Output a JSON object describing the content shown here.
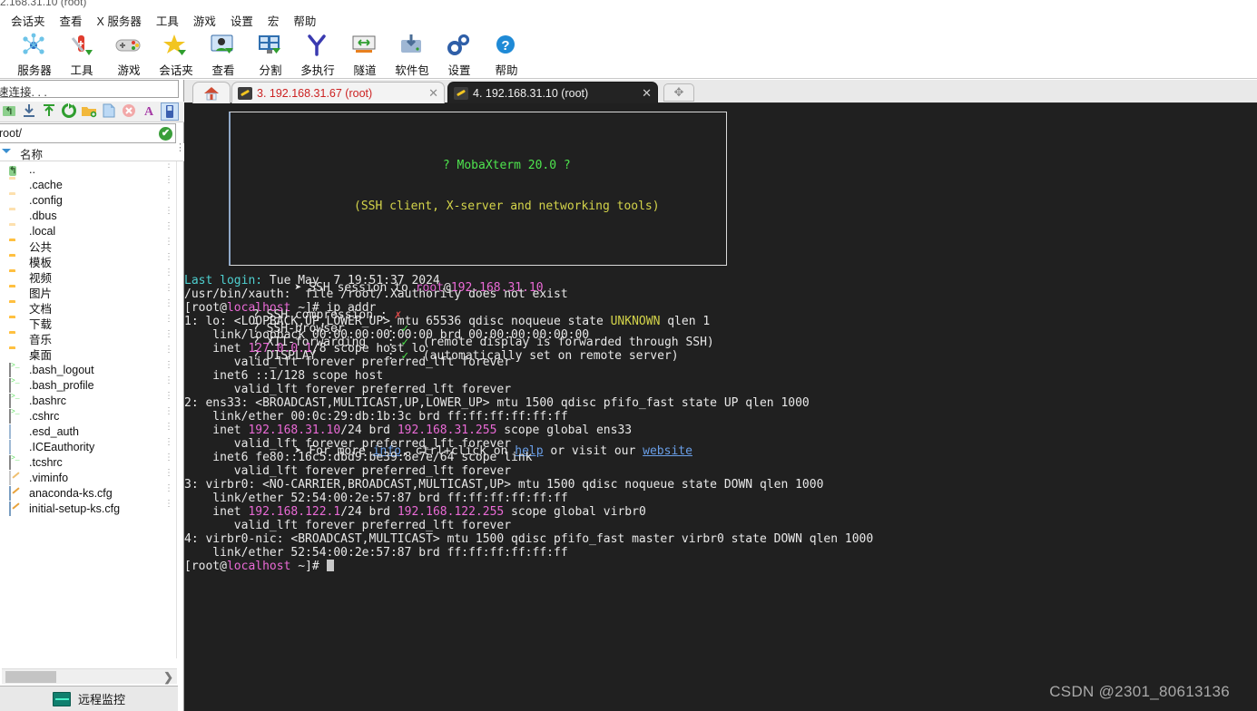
{
  "window": {
    "title": "2.168.31.10 (root)"
  },
  "menu": {
    "items": [
      "会话夹",
      "查看",
      "X 服务器",
      "工具",
      "游戏",
      "设置",
      "宏",
      "帮助"
    ]
  },
  "ribbon": {
    "buttons": [
      {
        "label": "服务器",
        "icon": "servers-icon"
      },
      {
        "label": "工具",
        "icon": "tools-icon"
      },
      {
        "label": "游戏",
        "icon": "games-icon"
      },
      {
        "label": "会话夹",
        "icon": "sessions-star-icon"
      },
      {
        "label": "查看",
        "icon": "view-icon"
      },
      {
        "label": "分割",
        "icon": "split-icon"
      },
      {
        "label": "多执行",
        "icon": "multiexec-icon"
      },
      {
        "label": "隧道",
        "icon": "tunnel-icon"
      },
      {
        "label": "软件包",
        "icon": "packages-icon"
      },
      {
        "label": "设置",
        "icon": "settings-gear-icon"
      },
      {
        "label": "帮助",
        "icon": "help-question-icon"
      }
    ]
  },
  "quick_connect": {
    "text": "速连接. . ."
  },
  "sftp": {
    "tools": [
      "upload-parent-icon",
      "download-icon",
      "upload-icon",
      "refresh-icon",
      "new-folder-icon",
      "new-file-icon",
      "delete-icon",
      "text-mode-icon",
      "drive-icon"
    ],
    "selected_tool_index": 8,
    "path": "root/",
    "path_ok": "✔",
    "column_header": "名称",
    "files": [
      {
        "name": "..",
        "icon": "up-folder-icon",
        "type": "up"
      },
      {
        "name": ".cache",
        "icon": "folder-icon",
        "type": "folder-light"
      },
      {
        "name": ".config",
        "icon": "folder-icon",
        "type": "folder-light"
      },
      {
        "name": ".dbus",
        "icon": "folder-icon",
        "type": "folder-light"
      },
      {
        "name": ".local",
        "icon": "folder-icon",
        "type": "folder-light"
      },
      {
        "name": "公共",
        "icon": "folder-icon",
        "type": "folder"
      },
      {
        "name": "模板",
        "icon": "folder-icon",
        "type": "folder"
      },
      {
        "name": "视频",
        "icon": "folder-icon",
        "type": "folder"
      },
      {
        "name": "图片",
        "icon": "folder-icon",
        "type": "folder"
      },
      {
        "name": "文档",
        "icon": "folder-icon",
        "type": "folder"
      },
      {
        "name": "下载",
        "icon": "folder-icon",
        "type": "folder"
      },
      {
        "name": "音乐",
        "icon": "folder-icon",
        "type": "folder"
      },
      {
        "name": "桌面",
        "icon": "folder-icon",
        "type": "folder"
      },
      {
        "name": ".bash_logout",
        "icon": "shell-file-icon",
        "type": "shell"
      },
      {
        "name": ".bash_profile",
        "icon": "shell-file-icon",
        "type": "shell"
      },
      {
        "name": ".bashrc",
        "icon": "shell-file-icon",
        "type": "shell"
      },
      {
        "name": ".cshrc",
        "icon": "shell-file-icon",
        "type": "shell"
      },
      {
        "name": ".esd_auth",
        "icon": "document-icon",
        "type": "doc"
      },
      {
        "name": ".ICEauthority",
        "icon": "document-icon",
        "type": "doc"
      },
      {
        "name": ".tcshrc",
        "icon": "shell-file-icon",
        "type": "shell"
      },
      {
        "name": ".viminfo",
        "icon": "viminfo-icon",
        "type": "vim"
      },
      {
        "name": "anaconda-ks.cfg",
        "icon": "config-file-icon",
        "type": "cfg"
      },
      {
        "name": "initial-setup-ks.cfg",
        "icon": "config-file-icon",
        "type": "cfg"
      }
    ]
  },
  "monitor_button": {
    "label": "远程监控",
    "icon": "monitor-graph-icon"
  },
  "tabs": {
    "home_label": "",
    "items": [
      {
        "label": "3. 192.168.31.67 (root)",
        "active": false
      },
      {
        "label": "4. 192.168.31.10 (root)",
        "active": true
      }
    ],
    "new_tab_label": "✥",
    "close_label": "✕"
  },
  "terminal": {
    "banner": {
      "title": "? MobaXterm 20.0 ?",
      "subtitle": "(SSH client, X-server and networking tools)",
      "session_prefix": "➤ SSH session to ",
      "session_user": "root",
      "session_at": "@",
      "session_host": "192.168.31.10",
      "rows": [
        {
          "label": "? SSH compression : ",
          "mark": "✗",
          "mark_color": "red",
          "note": ""
        },
        {
          "label": "? SSH-browser      : ",
          "mark": "✓",
          "mark_color": "green",
          "note": ""
        },
        {
          "label": "? X11-forwarding   : ",
          "mark": "✓",
          "mark_color": "green",
          "note": "  (remote display is forwarded through SSH)"
        },
        {
          "label": "? DISPLAY          : ",
          "mark": "✓",
          "mark_color": "green",
          "note": "  (automatically set on remote server)"
        }
      ],
      "footer_a": "➤ For more ",
      "footer_info": "info",
      "footer_b": ", ctrl+click on ",
      "footer_help": "help",
      "footer_c": " or visit our ",
      "footer_website": "website"
    },
    "lines": [
      {
        "segs": [
          {
            "t": "Last login:",
            "c": "c-cyan"
          },
          {
            "t": " Tue May  7 19:51:37 2024",
            "c": "c-white"
          }
        ]
      },
      {
        "segs": [
          {
            "t": "/usr/bin/xauth:  file /root/.Xauthority does not exist",
            "c": "c-white"
          }
        ]
      },
      {
        "segs": [
          {
            "t": "[root@",
            "c": "c-white"
          },
          {
            "t": "localhost",
            "c": "c-pink"
          },
          {
            "t": " ~]# ip addr",
            "c": "c-white"
          }
        ]
      },
      {
        "segs": [
          {
            "t": "1: lo: <LOOPBACK,UP,LOWER_UP> mtu 65536 qdisc noqueue state ",
            "c": "c-white"
          },
          {
            "t": "UNKNOWN",
            "c": "c-yellow"
          },
          {
            "t": " qlen 1",
            "c": "c-white"
          }
        ]
      },
      {
        "segs": [
          {
            "t": "    link/loopback 00:00:00:00:00:00 brd 00:00:00:00:00:00",
            "c": "c-white"
          }
        ]
      },
      {
        "segs": [
          {
            "t": "    inet ",
            "c": "c-white"
          },
          {
            "t": "127.0.0.1",
            "c": "c-pink"
          },
          {
            "t": "/8 scope host lo",
            "c": "c-white"
          }
        ]
      },
      {
        "segs": [
          {
            "t": "       valid_lft forever preferred_lft forever",
            "c": "c-white"
          }
        ]
      },
      {
        "segs": [
          {
            "t": "    inet6 ::1/128 scope host",
            "c": "c-white"
          }
        ]
      },
      {
        "segs": [
          {
            "t": "       valid_lft forever preferred_lft forever",
            "c": "c-white"
          }
        ]
      },
      {
        "segs": [
          {
            "t": "2: ens33: <BROADCAST,MULTICAST,UP,LOWER_UP> mtu 1500 qdisc pfifo_fast state UP qlen 1000",
            "c": "c-white"
          }
        ]
      },
      {
        "segs": [
          {
            "t": "    link/ether 00:0c:29:db:1b:3c brd ff:ff:ff:ff:ff:ff",
            "c": "c-white"
          }
        ]
      },
      {
        "segs": [
          {
            "t": "    inet ",
            "c": "c-white"
          },
          {
            "t": "192.168.31.10",
            "c": "c-pink"
          },
          {
            "t": "/24 brd ",
            "c": "c-white"
          },
          {
            "t": "192.168.31.255",
            "c": "c-pink"
          },
          {
            "t": " scope global ens33",
            "c": "c-white"
          }
        ]
      },
      {
        "segs": [
          {
            "t": "       valid_lft forever preferred_lft forever",
            "c": "c-white"
          }
        ]
      },
      {
        "segs": [
          {
            "t": "    inet6 fe80::16c5:dbd9:be39:8e7e/64 scope link",
            "c": "c-white"
          }
        ]
      },
      {
        "segs": [
          {
            "t": "       valid_lft forever preferred_lft forever",
            "c": "c-white"
          }
        ]
      },
      {
        "segs": [
          {
            "t": "3: virbr0: <NO-CARRIER,BROADCAST,MULTICAST,UP> mtu 1500 qdisc noqueue state DOWN qlen 1000",
            "c": "c-white"
          }
        ]
      },
      {
        "segs": [
          {
            "t": "    link/ether 52:54:00:2e:57:87 brd ff:ff:ff:ff:ff:ff",
            "c": "c-white"
          }
        ]
      },
      {
        "segs": [
          {
            "t": "    inet ",
            "c": "c-white"
          },
          {
            "t": "192.168.122.1",
            "c": "c-pink"
          },
          {
            "t": "/24 brd ",
            "c": "c-white"
          },
          {
            "t": "192.168.122.255",
            "c": "c-pink"
          },
          {
            "t": " scope global virbr0",
            "c": "c-white"
          }
        ]
      },
      {
        "segs": [
          {
            "t": "       valid_lft forever preferred_lft forever",
            "c": "c-white"
          }
        ]
      },
      {
        "segs": [
          {
            "t": "4: virbr0-nic: <BROADCAST,MULTICAST> mtu 1500 qdisc pfifo_fast master virbr0 state DOWN qlen 1000",
            "c": "c-white"
          }
        ]
      },
      {
        "segs": [
          {
            "t": "    link/ether 52:54:00:2e:57:87 brd ff:ff:ff:ff:ff:ff",
            "c": "c-white"
          }
        ]
      },
      {
        "segs": [
          {
            "t": "[root@",
            "c": "c-white"
          },
          {
            "t": "localhost",
            "c": "c-pink"
          },
          {
            "t": " ~]# ",
            "c": "c-white"
          },
          {
            "t": "",
            "c": "cursor"
          }
        ]
      }
    ]
  },
  "watermark": "CSDN @2301_80613136",
  "colors": {
    "terminal_bg": "#202020",
    "accent_blue": "#3a8fd0",
    "folder": "#ffc040",
    "active_tab_bg": "#232323"
  }
}
